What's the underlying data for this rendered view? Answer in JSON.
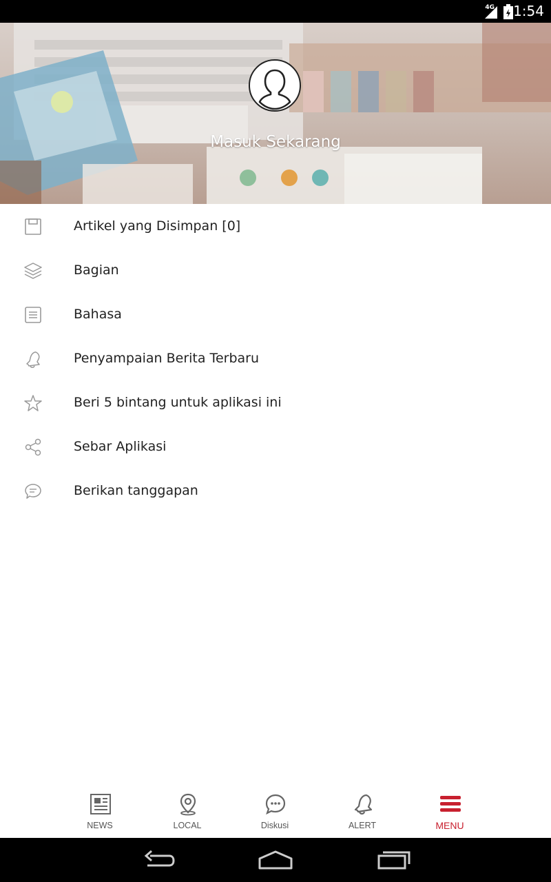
{
  "status_bar": {
    "time": "1:54",
    "network": "4G"
  },
  "header": {
    "login_label": "Masuk Sekarang"
  },
  "menu": {
    "items": [
      {
        "icon": "save-icon",
        "label": "Artikel yang Disimpan [0]"
      },
      {
        "icon": "layers-icon",
        "label": "Bagian"
      },
      {
        "icon": "document-icon",
        "label": "Bahasa"
      },
      {
        "icon": "bell-icon",
        "label": "Penyampaian Berita Terbaru"
      },
      {
        "icon": "star-icon",
        "label": "Beri 5 bintang untuk aplikasi ini"
      },
      {
        "icon": "share-icon",
        "label": "Sebar Aplikasi"
      },
      {
        "icon": "chat-icon",
        "label": "Berikan tanggapan"
      }
    ]
  },
  "bottom_nav": {
    "tabs": [
      {
        "icon": "newspaper-icon",
        "label": "NEWS"
      },
      {
        "icon": "location-icon",
        "label": "LOCAL"
      },
      {
        "icon": "chat-bubble-icon",
        "label": "Diskusi"
      },
      {
        "icon": "bell-icon",
        "label": "ALERT"
      },
      {
        "icon": "menu-icon",
        "label": "MENU",
        "active": true
      }
    ],
    "active_color": "#c8202f"
  }
}
